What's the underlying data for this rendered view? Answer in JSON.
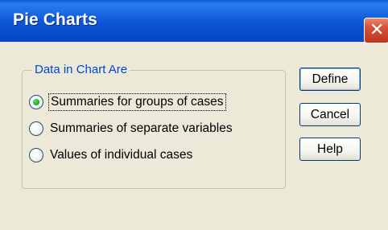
{
  "window": {
    "title": "Pie Charts"
  },
  "titlebar": {
    "close_glyph": "✕",
    "close_icon": "close-icon"
  },
  "group": {
    "legend": "Data in Chart Are",
    "options": [
      {
        "label": "Summaries for groups of cases",
        "selected": true
      },
      {
        "label": "Summaries of separate variables",
        "selected": false
      },
      {
        "label": "Values of individual cases",
        "selected": false
      }
    ]
  },
  "buttons": {
    "define": "Define",
    "cancel": "Cancel",
    "help": "Help"
  },
  "colors": {
    "titlebar": "#0b55d6",
    "legend_text": "#0046d5",
    "close_button": "#d5503a",
    "radio_selected": "#21a121"
  }
}
